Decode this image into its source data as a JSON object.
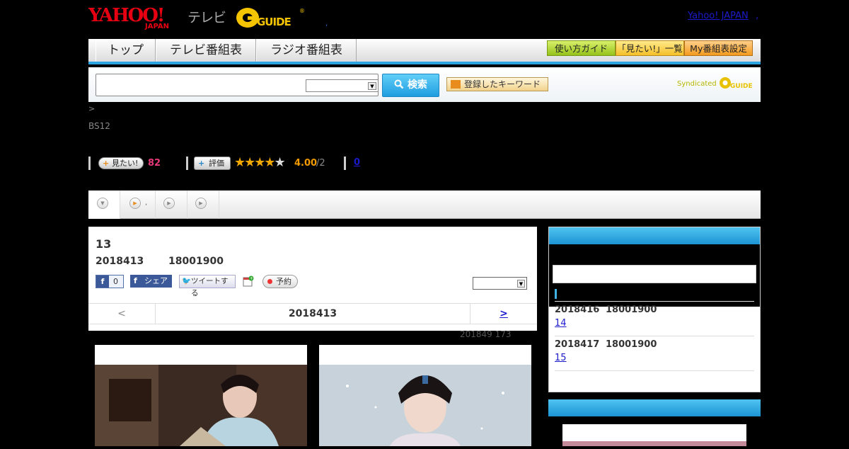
{
  "brand": {
    "yahoo_logo": "YAHOO! JAPAN",
    "tv_word": "テレビ",
    "gguide_logo": "G GUIDE",
    "yahoo_japan_link": "Yahoo! JAPAN",
    "link_comma": ","
  },
  "nav": {
    "tabs": [
      "トップ",
      "テレビ番組表",
      "ラジオ番組表"
    ],
    "tools": [
      "使い方ガイド",
      "「見たい!」一覧",
      "My番組表設定"
    ]
  },
  "search": {
    "button_label": "検索",
    "keyword_button": "登録したキーワード",
    "syndicated_label": "Syndicated"
  },
  "breadcrumb": ">",
  "channel": "BS12",
  "stats": {
    "want_label": "見たい!",
    "want_count": "82",
    "rate_label": "評価",
    "stars": "★★★★★",
    "rating": "4.00",
    "rating_of": "/2",
    "reviews": "0"
  },
  "episode": {
    "title": "13",
    "date": "2018413",
    "time": "18001900",
    "fb_count": "0",
    "fb_share": "シェア",
    "tweet": "ツイートする",
    "reserve": "予約"
  },
  "pager": {
    "prev": "<",
    "date": "2018413",
    "next": ">"
  },
  "updated": "201849  173",
  "sidebar": {
    "episodes": [
      {
        "date": "2018416",
        "time": "18001900",
        "link": "14"
      },
      {
        "date": "2018417",
        "time": "18001900",
        "link": "15"
      }
    ]
  },
  "colors": {
    "accent_blue": "#2aa3e0",
    "want_pink": "#e83a7a",
    "rating_orange": "#f39b00",
    "link_blue": "#1a1acc"
  }
}
